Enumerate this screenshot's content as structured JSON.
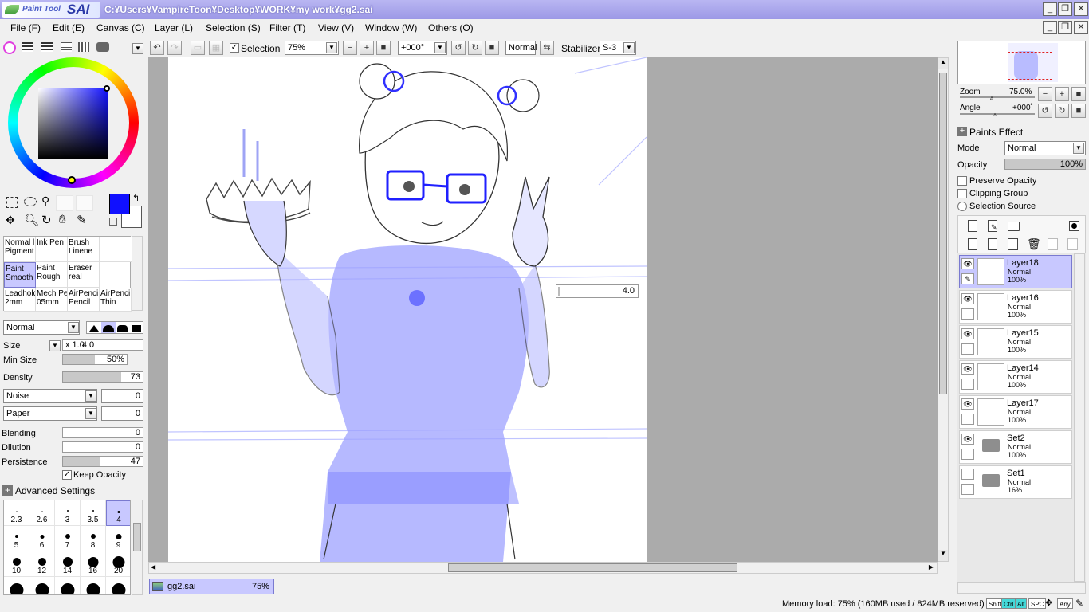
{
  "app": {
    "logo_text": "Paint Tool",
    "logo_text2": "SAI",
    "window_path": "C:¥Users¥VampireToon¥Desktop¥WORK¥my work¥gg2.sai"
  },
  "menus": [
    "File (F)",
    "Edit (E)",
    "Canvas (C)",
    "Layer (L)",
    "Selection (S)",
    "Filter (T)",
    "View (V)",
    "Window (W)",
    "Others (O)"
  ],
  "toolbar": {
    "selection_label": "Selection",
    "zoom_value": "75%",
    "angle_value": "+000°",
    "blend_mode": "Normal",
    "stabilizer_label": "Stabilizer",
    "stabilizer_value": "S-3"
  },
  "brushes": [
    [
      "Normal l",
      "Pigment"
    ],
    [
      "Ink Pen",
      ""
    ],
    [
      "Brush",
      "Linene"
    ],
    [
      "Paint",
      "Smooth"
    ],
    [
      "Paint",
      "Rough"
    ],
    [
      "Eraser",
      "real"
    ],
    [
      "Leadhold",
      "2mm"
    ],
    [
      "Mech Pe",
      "05mm"
    ],
    [
      "AirPenci",
      "Pencil"
    ],
    [
      "AirPenci",
      "Thin"
    ]
  ],
  "tool_settings": {
    "blend_mode": "Normal",
    "size_label": "Size",
    "size_multiplier": "x 1.0",
    "size_value": "4.0",
    "min_size_label": "Min Size",
    "min_size_value": "50%",
    "density_label": "Density",
    "density_value": "73",
    "noise_label": "Noise",
    "noise_value": "0",
    "paper_label": "Paper",
    "paper_value": "0",
    "blending_label": "Blending",
    "blending_value": "0",
    "dilution_label": "Dilution",
    "dilution_value": "0",
    "persistence_label": "Persistence",
    "persistence_value": "47",
    "keep_opacity_label": "Keep Opacity",
    "advanced_settings_label": "Advanced Settings"
  },
  "brush_sizes": [
    "2.3",
    "2.6",
    "3",
    "3.5",
    "4",
    "5",
    "6",
    "7",
    "8",
    "9",
    "10",
    "12",
    "14",
    "16",
    "20",
    "",
    "",
    "",
    "",
    ""
  ],
  "canvas": {
    "size_popup_value": "4.0"
  },
  "navigator": {
    "zoom_label": "Zoom",
    "zoom_value": "75.0%",
    "angle_label": "Angle",
    "angle_value": "+000˚"
  },
  "layer_props": {
    "paints_effect_label": "Paints Effect",
    "mode_label": "Mode",
    "mode_value": "Normal",
    "opacity_label": "Opacity",
    "opacity_value": "100%",
    "preserve_opacity_label": "Preserve Opacity",
    "clipping_group_label": "Clipping Group",
    "selection_source_label": "Selection Source"
  },
  "layers": [
    {
      "name": "Layer18",
      "mode": "Normal",
      "opacity": "100%"
    },
    {
      "name": "Layer16",
      "mode": "Normal",
      "opacity": "100%"
    },
    {
      "name": "Layer15",
      "mode": "Normal",
      "opacity": "100%"
    },
    {
      "name": "Layer14",
      "mode": "Normal",
      "opacity": "100%"
    },
    {
      "name": "Layer17",
      "mode": "Normal",
      "opacity": "100%"
    },
    {
      "name": "Set2",
      "mode": "Normal",
      "opacity": "100%"
    },
    {
      "name": "Set1",
      "mode": "Normal",
      "opacity": "16%"
    }
  ],
  "document_tab": {
    "name": "gg2.sai",
    "zoom": "75%"
  },
  "status": {
    "memory": "Memory load: 75% (160MB used / 824MB reserved)",
    "keys": [
      "Shift",
      "Ctrl",
      "Alt",
      "SPC",
      "Any"
    ]
  },
  "colors": {
    "current": "#1010ff",
    "title_bar": "#9c98e6",
    "selection": "#c8c8ff",
    "canvas_bg": "#ababab"
  }
}
